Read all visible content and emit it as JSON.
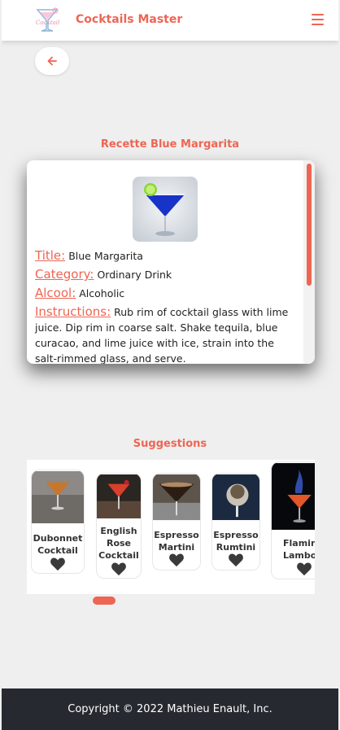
{
  "header": {
    "brand": "Cocktails Master",
    "logo_icon": "cocktail-glass-logo",
    "menu_icon": "hamburger-icon"
  },
  "back_button": {
    "icon": "arrow-left-icon"
  },
  "recipe": {
    "heading": "Recette Blue Margarita",
    "image_icon": "blue-margarita-photo",
    "fields": {
      "title_label": "Title:",
      "title_value": "Blue Margarita",
      "category_label": "Category:",
      "category_value": "Ordinary Drink",
      "alcool_label": "Alcool:",
      "alcool_value": "Alcoholic",
      "instructions_label": "Instructions:",
      "instructions_value": "Rub rim of cocktail glass with lime juice. Dip rim in coarse salt. Shake tequila, blue curacao, and lime juice with ice, strain into the salt-rimmed glass, and serve."
    }
  },
  "suggestions": {
    "heading": "Suggestions",
    "items": [
      {
        "name_line1": "Dubonnet",
        "name_line2": "Cocktail",
        "name_line3": ""
      },
      {
        "name_line1": "English",
        "name_line2": "Rose",
        "name_line3": "Cocktail"
      },
      {
        "name_line1": "Espresso",
        "name_line2": "Martini",
        "name_line3": ""
      },
      {
        "name_line1": "Espresso",
        "name_line2": "Rumtini",
        "name_line3": ""
      },
      {
        "name_line1": "Flaming",
        "name_line2": "Lamborghini",
        "name_line3": ""
      }
    ]
  },
  "footer": {
    "copyright": "Copyright © 2022 Mathieu Enault, Inc."
  },
  "colors": {
    "accent": "#ee6553",
    "footer_bg": "#262a30",
    "page_bg": "#efefef"
  }
}
